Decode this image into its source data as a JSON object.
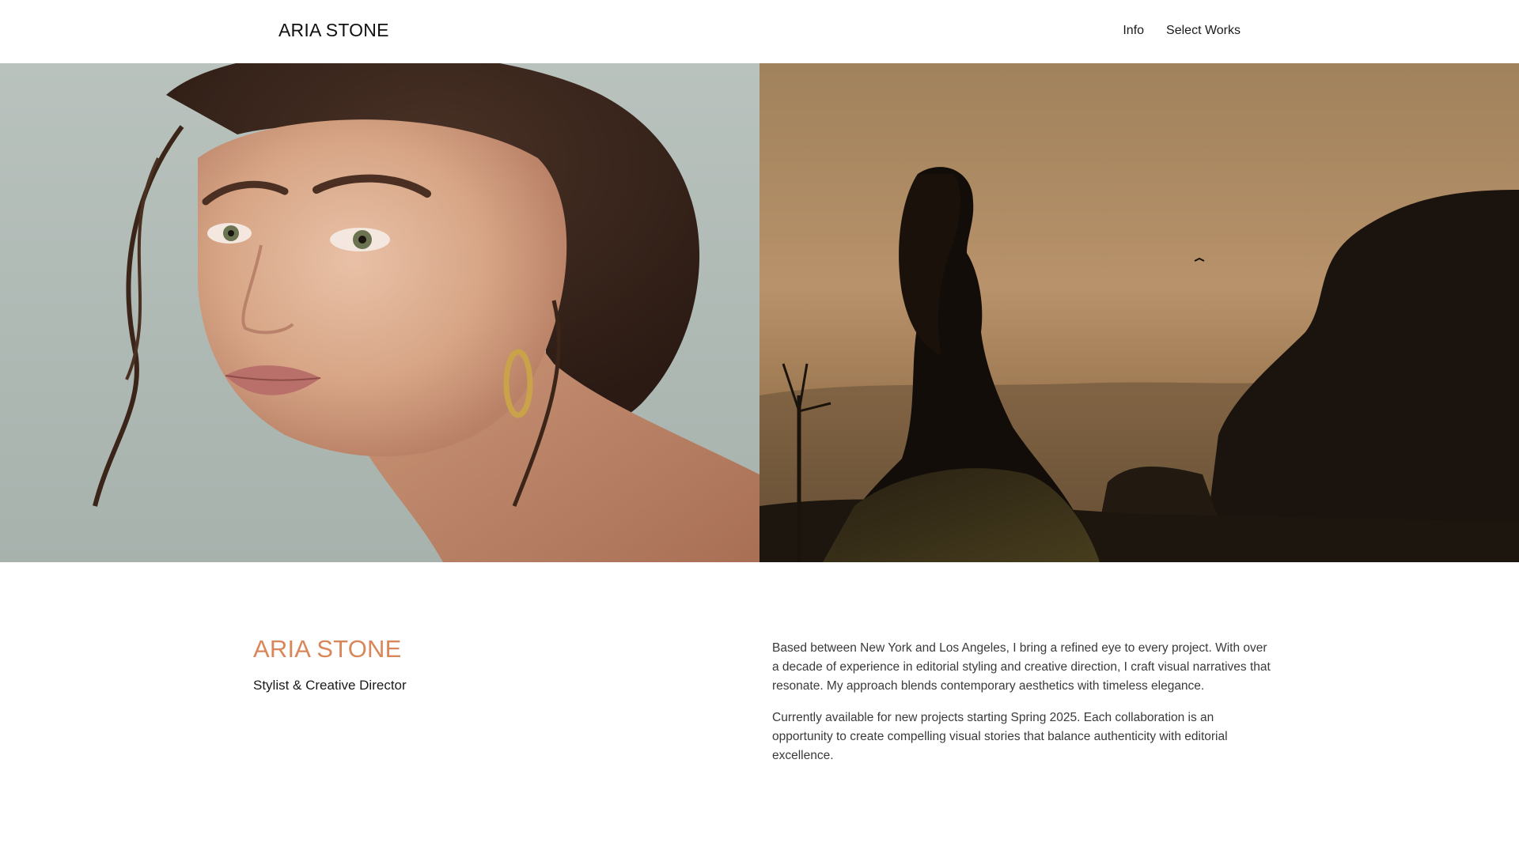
{
  "header": {
    "brand": "ARIA STONE",
    "nav": [
      {
        "label": "Info"
      },
      {
        "label": "Select Works"
      }
    ]
  },
  "hero": {
    "images": [
      {
        "subject": "Close-up beauty portrait of a woman with updo and gold hoop earring"
      },
      {
        "subject": "Silhouette of a woman in a flowing dress on a hillside at sunset"
      }
    ]
  },
  "about": {
    "name": "ARIA STONE",
    "role": "Stylist & Creative Director",
    "paragraphs": [
      "Based between New York and Los Angeles, I bring a refined eye to every project. With over a decade of experience in editorial styling and creative direction, I craft visual narratives that resonate. My approach blends contemporary aesthetics with timeless elegance.",
      "Currently available for new projects starting Spring 2025. Each collaboration is an opportunity to create compelling visual stories that balance authenticity with editorial excellence."
    ]
  },
  "colors": {
    "accent": "#D9875A",
    "text": "#1a1a1a",
    "body_text": "#3a3a3a",
    "background": "#ffffff"
  }
}
